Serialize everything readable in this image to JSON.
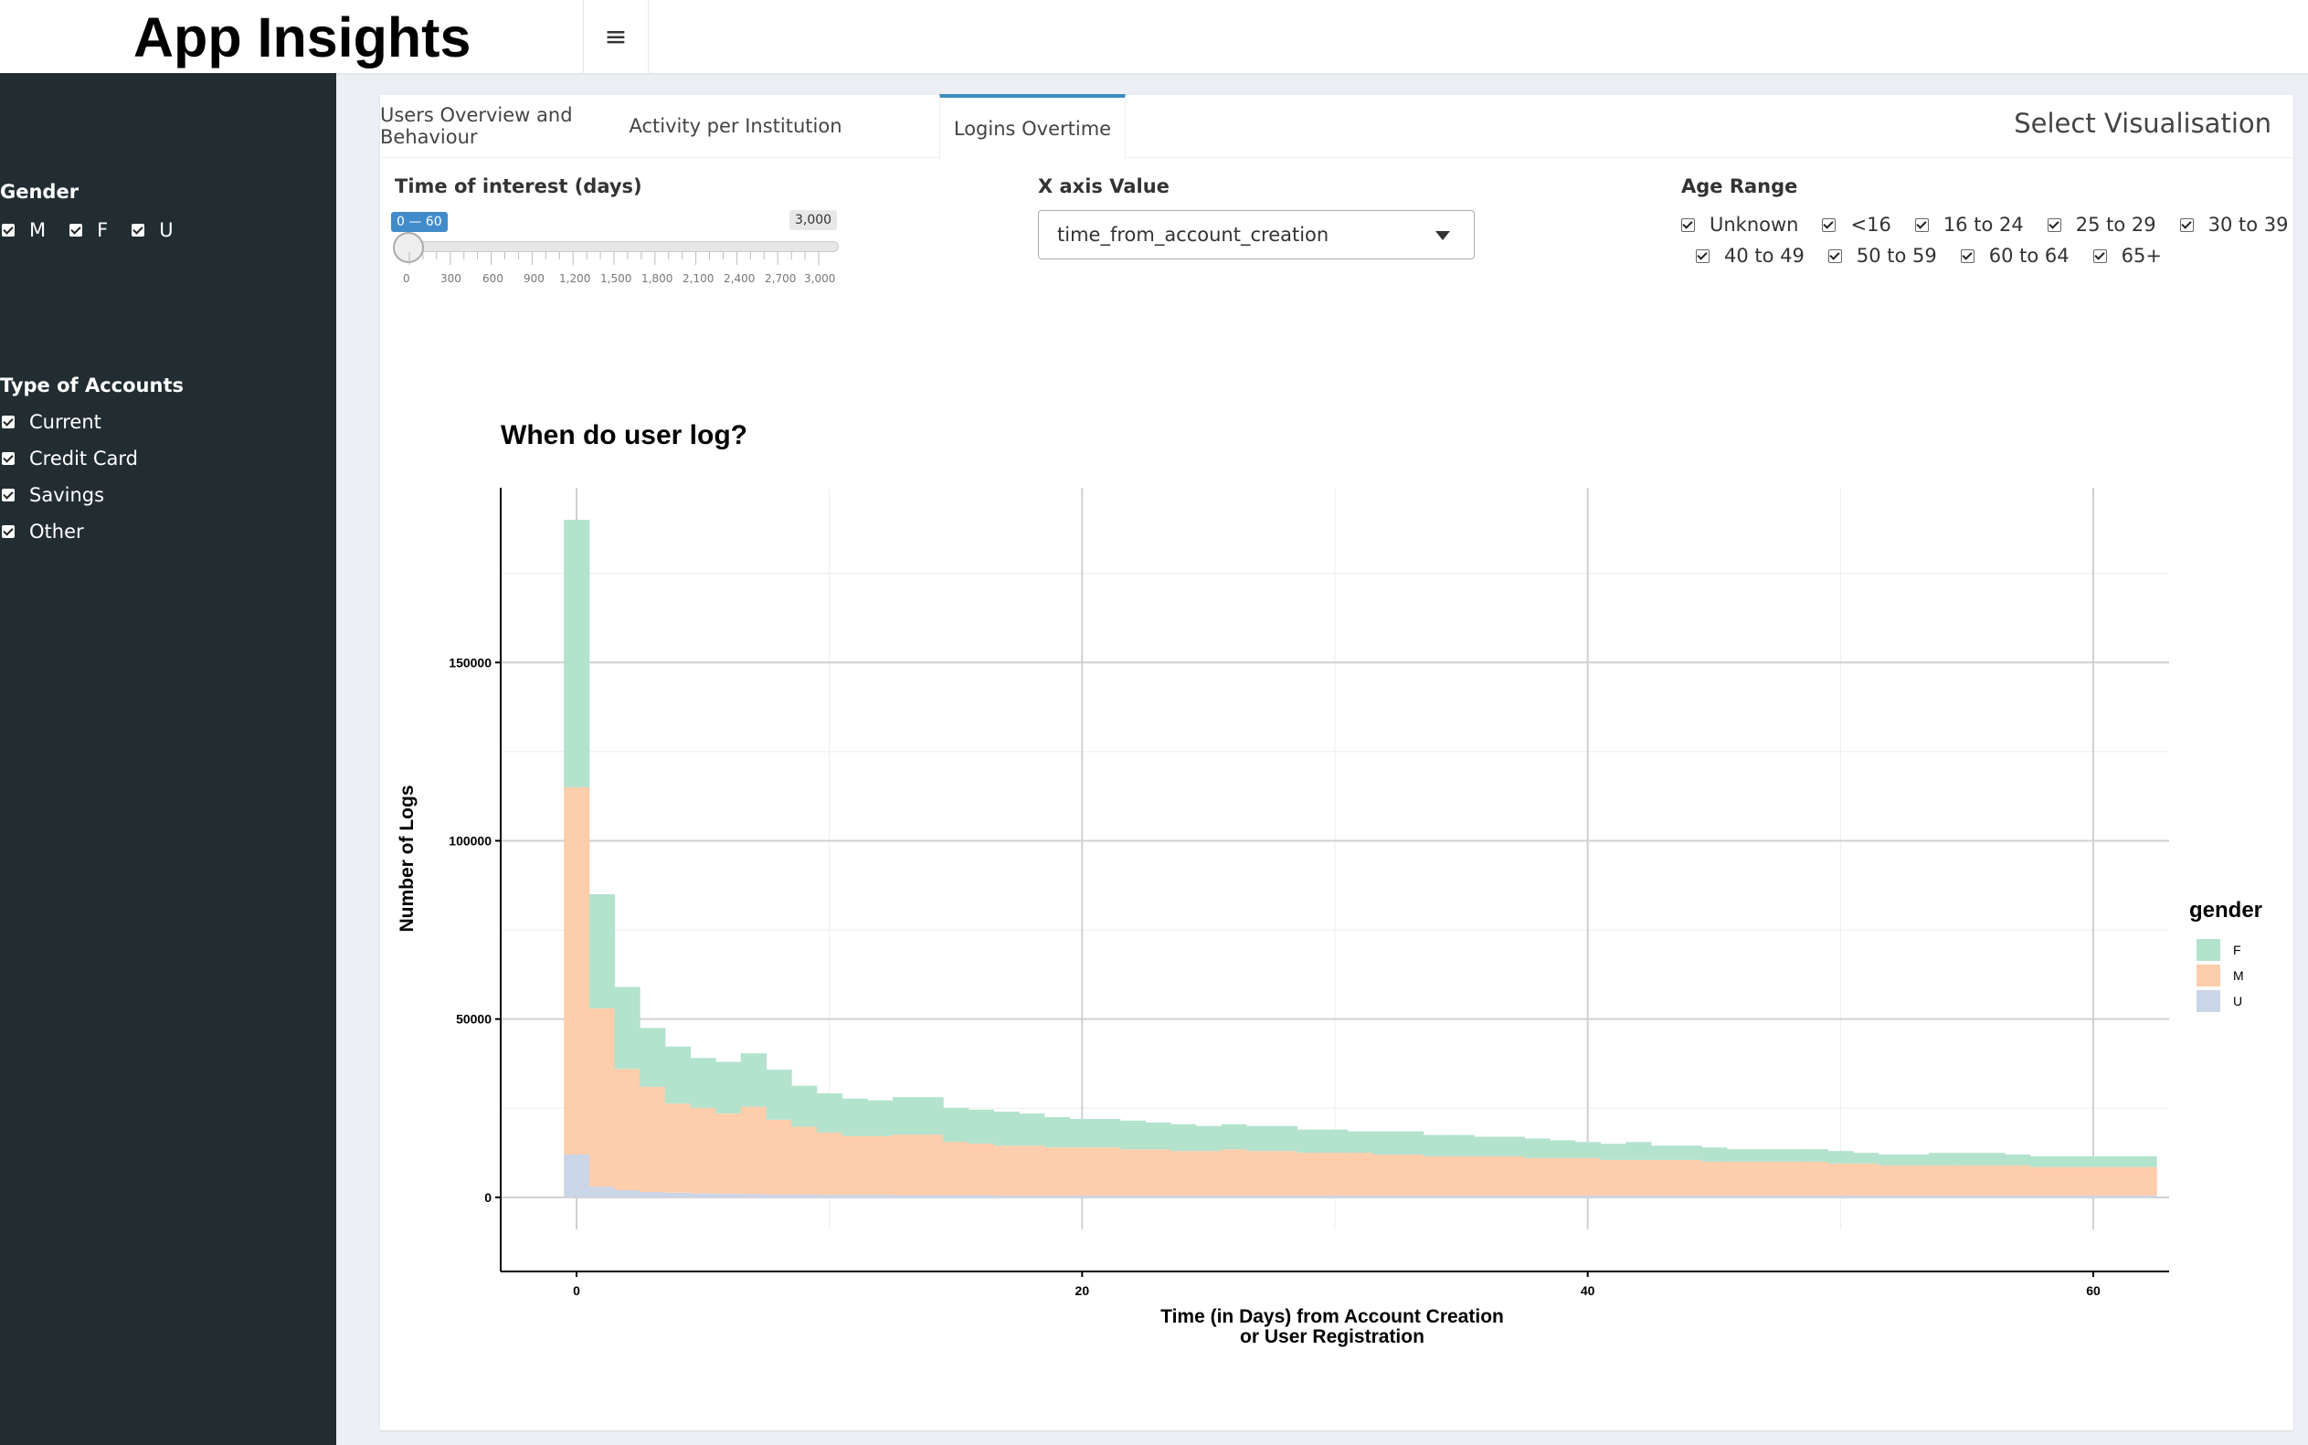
{
  "header": {
    "title": "App Insights",
    "menu_icon": "hamburger-icon"
  },
  "sidebar": {
    "gender": {
      "label": "Gender",
      "options": [
        {
          "label": "M",
          "checked": true
        },
        {
          "label": "F",
          "checked": true
        },
        {
          "label": "U",
          "checked": true
        }
      ]
    },
    "accounts": {
      "label": "Type of Accounts",
      "options": [
        {
          "label": "Current",
          "checked": true
        },
        {
          "label": "Credit Card",
          "checked": true
        },
        {
          "label": "Savings",
          "checked": true
        },
        {
          "label": "Other",
          "checked": true
        }
      ]
    }
  },
  "tabs": [
    {
      "label": "Users Overview and Behaviour"
    },
    {
      "label": "Activity per Institution"
    },
    {
      "label": "Logins Overtime",
      "active": true
    }
  ],
  "box_title": "Select Visualisation",
  "controls": {
    "time_label": "Time of interest (days)",
    "slider": {
      "from": 0,
      "to": 60,
      "min": 0,
      "max": 3000,
      "from_to_label": "0 — 60",
      "max_label": "3,000",
      "ticks": [
        "0",
        "300",
        "600",
        "900",
        "1,200",
        "1,500",
        "1,800",
        "2,100",
        "2,400",
        "2,700",
        "3,000"
      ]
    },
    "xaxis_label": "X axis Value",
    "xaxis_value": "time_from_account_creation",
    "age_label": "Age Range",
    "ages": [
      "Unknown",
      "<16",
      "16 to 24",
      "25 to 29",
      "30 to 39",
      "40 to 49",
      "50 to 59",
      "60 to 64",
      "65+"
    ]
  },
  "chart_data": {
    "type": "bar",
    "stacked": true,
    "title": "When do user log?",
    "xlabel": "Time (in Days) from Account Creation\nor User Registration",
    "ylabel": "Number of Logs",
    "xlim": [
      -3,
      63
    ],
    "ylim": [
      -9000,
      199000
    ],
    "xticks": [
      0,
      20,
      40,
      60
    ],
    "yticks": [
      0,
      50000,
      100000,
      150000
    ],
    "legend": {
      "title": "gender",
      "position": "right"
    },
    "colors": {
      "F": "#b3e2cd",
      "M": "#fdcdac",
      "U": "#cbd5e8"
    },
    "x": [
      0,
      1,
      2,
      3,
      4,
      5,
      6,
      7,
      8,
      9,
      10,
      11,
      12,
      13,
      14,
      15,
      16,
      17,
      18,
      19,
      20,
      21,
      22,
      23,
      24,
      25,
      26,
      27,
      28,
      29,
      30,
      31,
      32,
      33,
      34,
      35,
      36,
      37,
      38,
      39,
      40,
      41,
      42,
      43,
      44,
      45,
      46,
      47,
      48,
      49,
      50,
      51,
      52,
      53,
      54,
      55,
      55,
      57,
      58,
      59,
      60,
      61,
      62
    ],
    "series": [
      {
        "name": "U",
        "values": [
          12000,
          3000,
          2000,
          1500,
          1300,
          1100,
          1000,
          900,
          800,
          800,
          700,
          700,
          700,
          600,
          600,
          600,
          600,
          500,
          500,
          500,
          500,
          500,
          500,
          500,
          500,
          500,
          500,
          500,
          500,
          500,
          500,
          500,
          500,
          500,
          500,
          500,
          500,
          500,
          500,
          500,
          500,
          500,
          500,
          500,
          500,
          500,
          500,
          500,
          500,
          500,
          500,
          500,
          500,
          500,
          500,
          500,
          500,
          500,
          500,
          500,
          500,
          500,
          500
        ]
      },
      {
        "name": "M",
        "values": [
          103000,
          50000,
          34000,
          29500,
          25000,
          24000,
          22500,
          24500,
          21000,
          19000,
          17500,
          16500,
          16500,
          17000,
          17000,
          15000,
          14500,
          14000,
          14000,
          13500,
          13500,
          13500,
          13000,
          13000,
          12500,
          12500,
          13000,
          12500,
          12500,
          12000,
          12000,
          12000,
          11500,
          11500,
          11000,
          11000,
          11000,
          11000,
          10500,
          10500,
          10500,
          10000,
          10000,
          10000,
          10000,
          9500,
          9500,
          9500,
          9500,
          9500,
          9000,
          9000,
          8500,
          8500,
          8500,
          8500,
          8500,
          8500,
          8000,
          8000,
          8000,
          8000,
          8000
        ]
      },
      {
        "name": "F",
        "values": [
          75000,
          32000,
          23000,
          16500,
          16000,
          14000,
          14500,
          15000,
          14000,
          11500,
          11000,
          10500,
          10000,
          10500,
          10500,
          9500,
          9500,
          9500,
          9000,
          8500,
          8000,
          8000,
          8000,
          7500,
          7500,
          7000,
          7000,
          7000,
          7000,
          6500,
          6500,
          6000,
          6500,
          6500,
          6000,
          6000,
          5500,
          5500,
          5500,
          5000,
          4500,
          4500,
          5000,
          4000,
          4000,
          4000,
          3500,
          3500,
          3500,
          3500,
          3500,
          3000,
          3000,
          3000,
          3500,
          3500,
          3500,
          3000,
          3000,
          3000,
          3000,
          3000,
          3000
        ]
      }
    ]
  }
}
